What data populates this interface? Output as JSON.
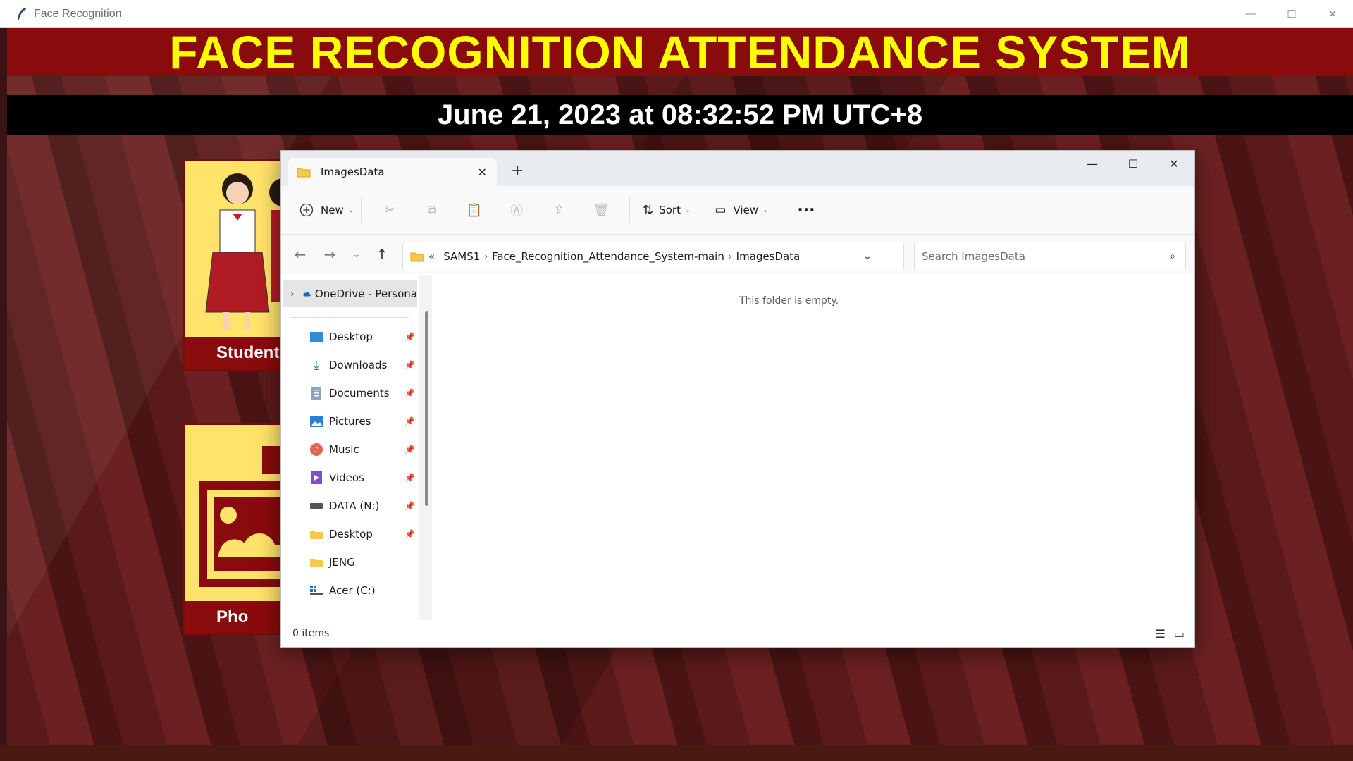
{
  "app": {
    "title": "Face Recognition",
    "controls": {
      "minimize": "—",
      "maximize": "☐",
      "close": "✕"
    },
    "header_title": "FACE RECOGNITION ATTENDANCE SYSTEM",
    "datetime": "June 21, 2023 at 08:32:52 PM UTC+8",
    "tiles": [
      {
        "label": "Student"
      },
      {
        "label": "Pho"
      }
    ],
    "colors": {
      "banner": "#8a0b0b",
      "banner_text": "#ffff00",
      "date_bar": "#000000",
      "tile_bg": "#ffe36a"
    }
  },
  "explorer": {
    "tab": {
      "label": "ImagesData",
      "close": "✕"
    },
    "new_tab": "+",
    "window_controls": {
      "minimize": "—",
      "maximize": "☐",
      "close": "✕"
    },
    "toolbar": {
      "new_label": "New",
      "sort_label": "Sort",
      "view_label": "View",
      "more": "···",
      "icons": [
        "cut-icon",
        "copy-icon",
        "paste-icon",
        "rename-icon",
        "share-icon",
        "delete-icon"
      ]
    },
    "address": {
      "overflow": "«",
      "segments": [
        "SAMS1",
        "Face_Recognition_Attendance_System-main",
        "ImagesData"
      ]
    },
    "search": {
      "placeholder": "Search ImagesData"
    },
    "nav": {
      "onedrive": "OneDrive - Persona",
      "items": [
        {
          "label": "Desktop",
          "icon": "desktop-icon",
          "pinned": true
        },
        {
          "label": "Downloads",
          "icon": "download-icon",
          "pinned": true
        },
        {
          "label": "Documents",
          "icon": "documents-icon",
          "pinned": true
        },
        {
          "label": "Pictures",
          "icon": "pictures-icon",
          "pinned": true
        },
        {
          "label": "Music",
          "icon": "music-icon",
          "pinned": true
        },
        {
          "label": "Videos",
          "icon": "videos-icon",
          "pinned": true
        },
        {
          "label": "DATA (N:)",
          "icon": "drive-icon",
          "pinned": true
        },
        {
          "label": "Desktop",
          "icon": "folder-icon",
          "pinned": true
        },
        {
          "label": "JENG",
          "icon": "folder-icon",
          "pinned": false
        },
        {
          "label": "Acer (C:)",
          "icon": "windows-drive-icon",
          "pinned": false
        }
      ]
    },
    "content": {
      "empty_message": "This folder is empty."
    },
    "status": {
      "items": "0 items"
    }
  }
}
